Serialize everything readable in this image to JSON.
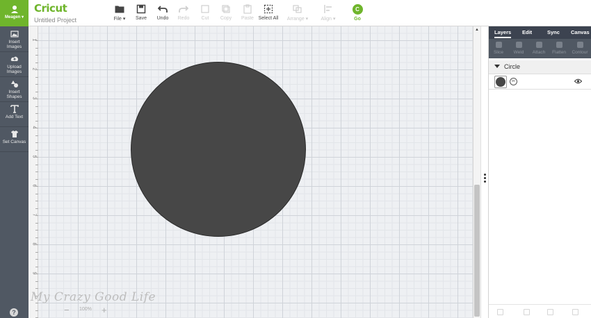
{
  "app": {
    "logo": "Cricut",
    "project_title": "Untitled Project"
  },
  "toolbar": {
    "items": [
      {
        "id": "file",
        "label": "File ▾",
        "enabled": true
      },
      {
        "id": "save",
        "label": "Save",
        "enabled": true
      },
      {
        "id": "undo",
        "label": "Undo",
        "enabled": true
      },
      {
        "id": "redo",
        "label": "Redo",
        "enabled": false
      },
      {
        "id": "cut",
        "label": "Cut",
        "enabled": false
      },
      {
        "id": "copy",
        "label": "Copy",
        "enabled": false
      },
      {
        "id": "paste",
        "label": "Paste",
        "enabled": false
      },
      {
        "id": "select_all",
        "label": "Select All",
        "enabled": true
      },
      {
        "id": "arrange",
        "label": "Arrange ▾",
        "enabled": false
      },
      {
        "id": "align",
        "label": "Align ▾",
        "enabled": false
      }
    ],
    "go": {
      "icon_letter": "C",
      "label": "Go"
    }
  },
  "sidebar": {
    "user_name": "Meagen ▾",
    "items": [
      {
        "id": "insert_images",
        "label_lines": [
          "Insert",
          "Images"
        ],
        "icon": "image-icon"
      },
      {
        "id": "upload_images",
        "label_lines": [
          "Upload",
          "Images"
        ],
        "icon": "cloud-upload-icon"
      },
      {
        "id": "insert_shapes",
        "label_lines": [
          "Insert",
          "Shapes"
        ],
        "icon": "shapes-icon"
      },
      {
        "id": "add_text",
        "label_lines": [
          "Add Text"
        ],
        "icon": "text-icon"
      },
      {
        "id": "set_canvas",
        "label_lines": [
          "Set Canvas"
        ],
        "icon": "tshirt-icon"
      }
    ],
    "help": "?"
  },
  "ruler": {
    "numbers": [
      "1",
      "2",
      "3",
      "4",
      "5",
      "6",
      "7",
      "8",
      "9"
    ]
  },
  "canvas": {
    "zoom_out": "−",
    "zoom_level": "100%",
    "zoom_in": "+",
    "shape_fill": "#474747"
  },
  "watermark": "My Crazy Good Life",
  "panel": {
    "tabs": [
      "Layers",
      "Edit",
      "Sync",
      "Canvas"
    ],
    "tools": [
      "Slice",
      "Weld",
      "Attach",
      "Flatten",
      "Contour"
    ],
    "group_name": "Circle"
  },
  "colors": {
    "accent": "#6fb52c",
    "sidebar": "#505863",
    "panel_header": "#3c4350"
  }
}
